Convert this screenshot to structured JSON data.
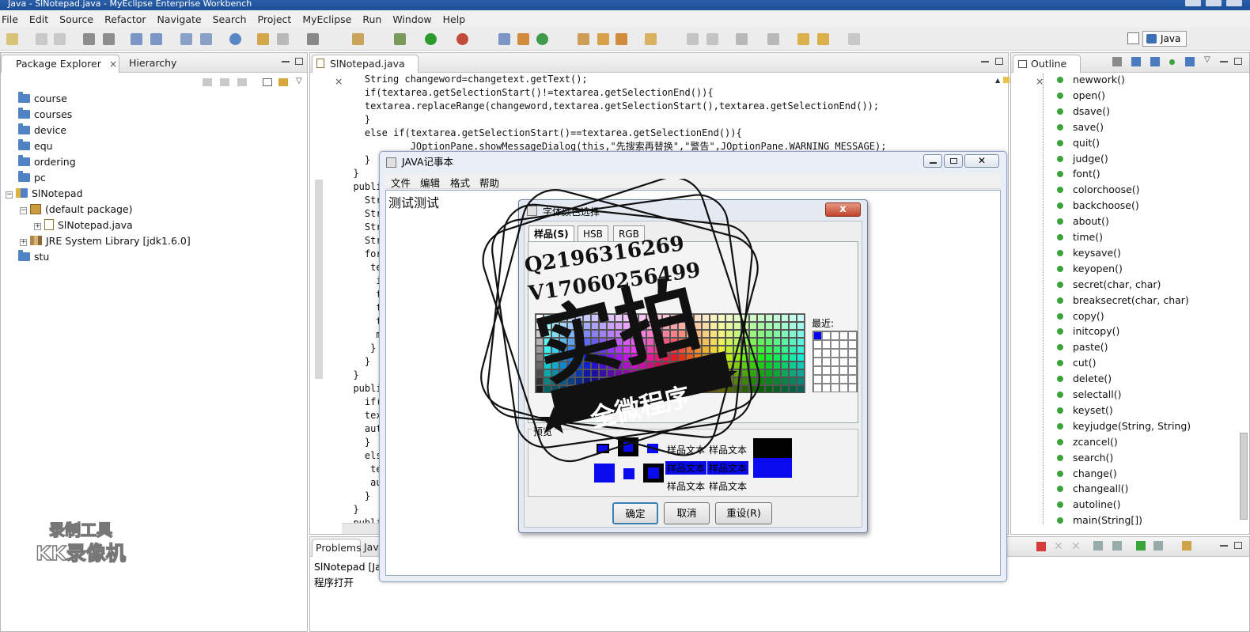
{
  "window": {
    "title": "Java - SlNotepad.java - MyEclipse Enterprise Workbench"
  },
  "menu": [
    "File",
    "Edit",
    "Source",
    "Refactor",
    "Navigate",
    "Search",
    "Project",
    "MyEclipse",
    "Run",
    "Window",
    "Help"
  ],
  "perspective": {
    "label": "Java"
  },
  "package_explorer": {
    "tabs": [
      "Package Explorer",
      "Hierarchy"
    ],
    "items": [
      {
        "label": "course"
      },
      {
        "label": "courses"
      },
      {
        "label": "device"
      },
      {
        "label": "equ"
      },
      {
        "label": "ordering"
      },
      {
        "label": "pc"
      },
      {
        "label": "SlNotepad"
      },
      {
        "label": "(default package)"
      },
      {
        "label": "SlNotepad.java"
      },
      {
        "label": "JRE System Library [jdk1.6.0]"
      },
      {
        "label": "stu"
      }
    ]
  },
  "editor": {
    "tab": "SlNotepad.java",
    "lines": [
      "    String changeword=changetext.getText();",
      "    if(textarea.getSelectionStart()!=textarea.getSelectionEnd()){",
      "    textarea.replaceRange(changeword,textarea.getSelectionStart(),textarea.getSelectionEnd());",
      "    }",
      "    else if(textarea.getSelectionStart()==textarea.getSelectionEnd()){",
      "            JOptionPane.showMessageDialog(this,\"先搜索再替换\",\"警告\",JOptionPane.WARNING_MESSAGE);",
      "    }",
      "  }",
      "  public",
      "    Strin",
      "    Strin",
      "    Strin",
      "    Strin",
      "    for(i",
      "     temp",
      "      if(",
      "      tex",
      "      tex",
      "      tex",
      "      mai",
      "     }",
      "    }",
      "  }",
      "  public",
      "    if(!t",
      "    texta",
      "    autol",
      "    }",
      "    else",
      "     text",
      "     auto",
      "    }",
      "  }",
      "  public"
    ]
  },
  "outline": {
    "tab": "Outline",
    "items": [
      "newwork()",
      "open()",
      "dsave()",
      "save()",
      "quit()",
      "judge()",
      "font()",
      "colorchoose()",
      "backchoose()",
      "about()",
      "time()",
      "keysave()",
      "keyopen()",
      "secret(char, char)",
      "breaksecret(char, char)",
      "copy()",
      "initcopy()",
      "paste()",
      "cut()",
      "delete()",
      "selectall()",
      "keyset()",
      "keyjudge(String, String)",
      "zcancel()",
      "search()",
      "change()",
      "changeall()",
      "autoline()",
      "main(String[])"
    ]
  },
  "console": {
    "tabs": [
      "Problems",
      "Java"
    ],
    "header": "SlNotepad [Jav",
    "output": "程序打开"
  },
  "notepad": {
    "title": "JAVA记事本",
    "menu": [
      "文件",
      "编辑",
      "格式",
      "帮助"
    ],
    "content": "测试测试"
  },
  "color_chooser": {
    "title": "字体颜色选择",
    "close": "x",
    "tabs": [
      "样品(S)",
      "HSB",
      "RGB"
    ],
    "recent_label": "最近:",
    "preview_label": "预览",
    "sample_text": "样品文本",
    "buttons": {
      "ok": "确定",
      "cancel": "取消",
      "reset": "重设(R)"
    },
    "selected_color": "#0000ff"
  },
  "stamp": {
    "line1": "Q2196316269",
    "line2": "V17060256499",
    "big": "实拍",
    "banner": "全微程序"
  },
  "watermark": {
    "line1": "录制工具",
    "line2": "KK录像机"
  }
}
